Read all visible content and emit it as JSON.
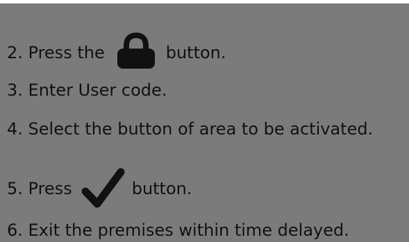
{
  "colors": {
    "background": "#7b7b7b",
    "text": "#111111",
    "icon": "#111111",
    "top_border": "#ffffff"
  },
  "instructions": {
    "step2": {
      "before_icon": "2. Press the",
      "icon": "lock-icon",
      "after_icon": "button."
    },
    "step3": {
      "text": "3. Enter User code."
    },
    "step4": {
      "text": "4. Select the button of area to be activated."
    },
    "step5": {
      "before_icon": "5. Press",
      "icon": "checkmark-icon",
      "after_icon": "button."
    },
    "step6": {
      "text": "6. Exit the premises within time delayed."
    }
  }
}
